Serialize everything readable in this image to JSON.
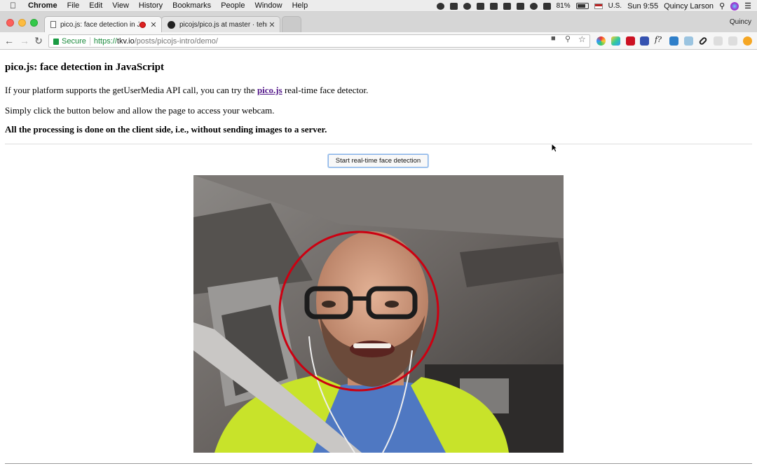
{
  "menubar": {
    "app_name": "Chrome",
    "menus": [
      "File",
      "Edit",
      "View",
      "History",
      "Bookmarks",
      "People",
      "Window",
      "Help"
    ],
    "battery": "81%",
    "input_source": "U.S.",
    "clock": "Sun 9:55",
    "user": "Quincy Larson"
  },
  "tabs": [
    {
      "title": "pico.js: face detection in Ja",
      "recording": true,
      "icon": "document-icon"
    },
    {
      "title": "picojs/pico.js at master · tehn",
      "recording": false,
      "icon": "github-icon"
    }
  ],
  "profile_name": "Quincy",
  "address_bar": {
    "secure_label": "Secure",
    "scheme": "https://",
    "host": "tkv.io",
    "path": "/posts/picojs-intro/demo/"
  },
  "page": {
    "heading": "pico.js: face detection in JavaScript",
    "intro_before": "If your platform supports the getUserMedia API call, you can try the ",
    "intro_link": "pico.js",
    "intro_after": " real-time face detector.",
    "instruction": "Simply click the button below and allow the page to access your webcam.",
    "note": "All the processing is done on the client side, i.e., without sending images to a server.",
    "button_label": "Start real-time face detection"
  },
  "detection": {
    "circle_color": "#cc0011"
  }
}
